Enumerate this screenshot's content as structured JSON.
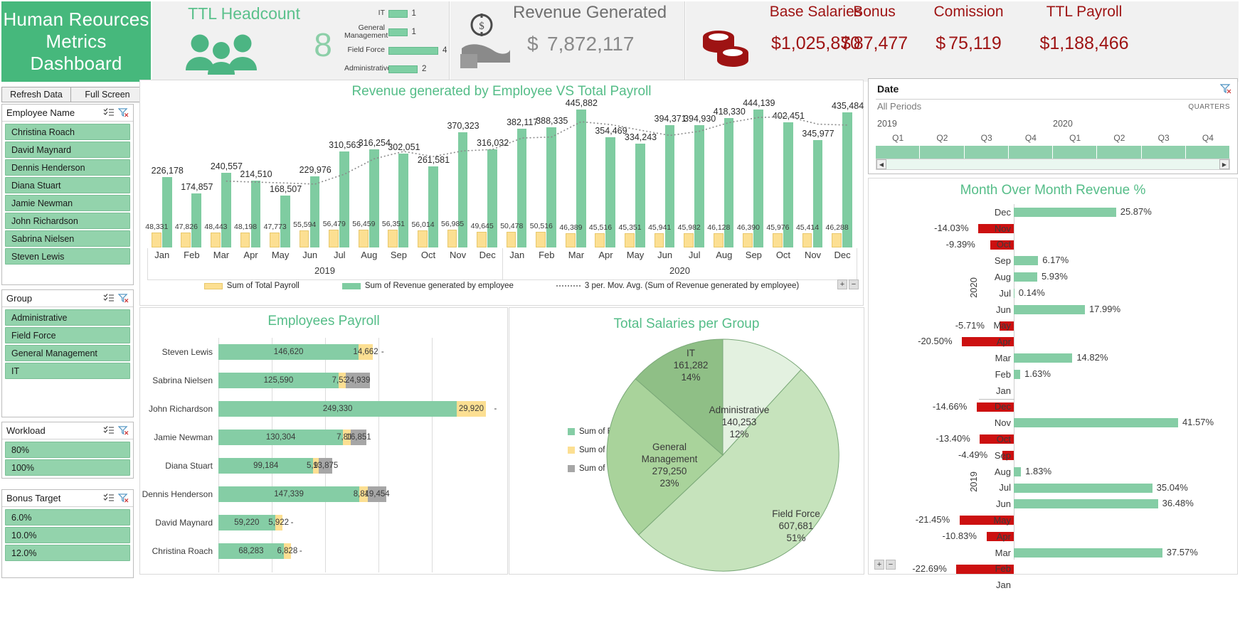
{
  "header": {
    "title": "Human Reources Metrics Dashboard",
    "headcount": {
      "label": "TTL Headcount",
      "total": "8",
      "groups": [
        {
          "label": "IT",
          "value": "1",
          "count": 1
        },
        {
          "label": "General Management",
          "value": "1",
          "count": 1
        },
        {
          "label": "Field Force",
          "value": "4",
          "count": 4
        },
        {
          "label": "Administrative",
          "value": "2",
          "count": 2
        }
      ]
    },
    "revenue": {
      "label": "Revenue Generated",
      "currency": "$",
      "value": "7,872,117",
      "icon": "money-hand-icon"
    },
    "payroll": {
      "icon": "coins-icon",
      "items": [
        {
          "label": "Base Salaries",
          "currency": "",
          "amount": "$1,025,870"
        },
        {
          "label": "Bonus",
          "currency": "$",
          "amount": "87,477"
        },
        {
          "label": "Comission",
          "currency": "$",
          "amount": "75,119"
        },
        {
          "label": "TTL Payroll",
          "currency": "",
          "amount": "$1,188,466"
        }
      ]
    }
  },
  "toolbar": {
    "refresh_label": "Refresh Data",
    "fullscreen_label": "Full Screen"
  },
  "slicers": [
    {
      "title": "Employee Name",
      "items": [
        "Christina Roach",
        "David Maynard",
        "Dennis Henderson",
        "Diana Stuart",
        "Jamie Newman",
        "John Richardson",
        "Sabrina Nielsen",
        "Steven Lewis"
      ]
    },
    {
      "title": "Group",
      "items": [
        "Administrative",
        "Field Force",
        "General Management",
        "IT"
      ]
    },
    {
      "title": "Workload",
      "items": [
        "80%",
        "100%"
      ]
    },
    {
      "title": "Bonus Target",
      "items": [
        "6.0%",
        "10.0%",
        "12.0%"
      ]
    }
  ],
  "timeline": {
    "title": "Date",
    "period": "All Periods",
    "granularity": "QUARTERS",
    "years": [
      "2019",
      "2020"
    ],
    "quarters": [
      "Q1",
      "Q2",
      "Q3",
      "Q4",
      "Q1",
      "Q2",
      "Q3",
      "Q4"
    ]
  },
  "chart_data": [
    {
      "id": "revenue_vs_payroll",
      "type": "bar",
      "title": "Revenue generated by Employee VS Total Payroll",
      "xlabel": "",
      "ylabel": "",
      "grid": false,
      "legend_position": "bottom",
      "group_labels": [
        "2019",
        "2020"
      ],
      "categories": [
        "Jan",
        "Feb",
        "Mar",
        "Apr",
        "May",
        "Jun",
        "Jul",
        "Aug",
        "Sep",
        "Oct",
        "Nov",
        "Dec",
        "Jan",
        "Feb",
        "Mar",
        "Apr",
        "May",
        "Jun",
        "Jul",
        "Aug",
        "Sep",
        "Oct",
        "Nov",
        "Dec"
      ],
      "series": [
        {
          "name": "Sum of Total Payroll",
          "color": "#fcdf92",
          "values": [
            48331,
            47826,
            48443,
            48198,
            47773,
            55594,
            56479,
            56459,
            56351,
            56014,
            56985,
            49645,
            50478,
            50516,
            46389,
            45516,
            45351,
            45941,
            45982,
            46128,
            46390,
            45976,
            45414,
            46288
          ],
          "labels": [
            "48,331",
            "47,826",
            "48,443",
            "48,198",
            "47,773",
            "55,594",
            "56,479",
            "56,459",
            "56,351",
            "56,014",
            "56,985",
            "49,645",
            "50,478",
            "50,516",
            "46,389",
            "45,516",
            "45,351",
            "45,941",
            "45,982",
            "46,128",
            "46,390",
            "45,976",
            "45,414",
            "46,288"
          ]
        },
        {
          "name": "Sum of Revenue generated by employee",
          "color": "#7fcca1",
          "values": [
            226178,
            174857,
            240557,
            214510,
            168507,
            229976,
            310563,
            316254,
            302051,
            261581,
            370323,
            316032,
            382117,
            388335,
            445882,
            354469,
            334243,
            394371,
            394930,
            418330,
            444139,
            402451,
            345977,
            435484
          ],
          "labels": [
            "226,178",
            "174,857",
            "240,557",
            "214,510",
            "168,507",
            "229,976",
            "310,563",
            "316,254",
            "302,051",
            "261,581",
            "370,323",
            "316,032",
            "382,117",
            "388,335",
            "445,882",
            "354,469",
            "334,243",
            "394,371",
            "394,930",
            "418,330",
            "444,139",
            "402,451",
            "345,977",
            "435,484"
          ]
        },
        {
          "name": "3 per. Mov. Avg. (Sum of Revenue generated by employee)",
          "color": "#8a8a8a",
          "type": "line",
          "style": "dotted",
          "values": [
            null,
            null,
            213864,
            210641,
            207858,
            204331,
            236349,
            285598,
            309623,
            293295,
            311318,
            315979,
            352812,
            356161,
            405445,
            396229,
            378198,
            361028,
            374515,
            402544,
            419133,
            421640,
            397522,
            394637
          ]
        }
      ]
    },
    {
      "id": "employees_payroll",
      "type": "bar",
      "orientation": "horizontal",
      "stacked": true,
      "title": "Employees Payroll",
      "categories": [
        "Steven Lewis",
        "Sabrina Nielsen",
        "John Richardson",
        "Jamie Newman",
        "Diana Stuart",
        "Dennis Henderson",
        "David Maynard",
        "Christina Roach"
      ],
      "series": [
        {
          "name": "Sum of Base salary",
          "color": "#85cda5",
          "values": [
            146620,
            125590,
            249330,
            130304,
            99184,
            147339,
            59220,
            68283
          ],
          "labels": [
            "146,620",
            "125,590",
            "249,330",
            "130,304",
            "99,184",
            "147,339",
            "59,220",
            "68,283"
          ]
        },
        {
          "name": "Sum of Bonus accrual",
          "color": "#fcdf92",
          "values": [
            14662,
            7535,
            29920,
            7818,
            5951,
            8840,
            5922,
            6828
          ],
          "labels": [
            "14,662",
            "7,535",
            "29,920",
            "7,818",
            "5,951",
            "8,840",
            "5,922",
            "6,828"
          ]
        },
        {
          "name": "Sum of Comission",
          "color": "#a6a6a6",
          "values": [
            0,
            24939,
            0,
            16851,
            13875,
            19454,
            0,
            0
          ],
          "labels": [
            "-",
            "24,939",
            "-",
            "16,851",
            "13,875",
            "19,454",
            "-",
            "-"
          ]
        }
      ]
    },
    {
      "id": "total_salaries_per_group",
      "type": "pie",
      "title": "Total Salaries per Group",
      "legend_position": "left",
      "legend_entries": [
        "Sum of Base salary",
        "Sum of Bonus accrual",
        "Sum of Comission"
      ],
      "categories": [
        "Administrative",
        "Field Force",
        "General Management",
        "IT"
      ],
      "values": [
        140253,
        607681,
        279250,
        161282
      ],
      "percents": [
        "12%",
        "51%",
        "23%",
        "14%"
      ],
      "labels": [
        "140,253",
        "607,681",
        "279,250",
        "161,282"
      ],
      "colors": [
        "#e3f1e0",
        "#c6e3bc",
        "#a9d39b",
        "#8fbf86"
      ]
    },
    {
      "id": "month_over_month_revenue",
      "type": "bar",
      "orientation": "horizontal",
      "title": "Month Over Month Revenue %",
      "group_labels": [
        "2020",
        "2019"
      ],
      "positive_color": "#85cda5",
      "negative_color": "#cc1010",
      "rows": [
        {
          "year": "2020",
          "month": "Dec",
          "value": 25.87,
          "label": "25.87%"
        },
        {
          "year": "2020",
          "month": "Nov",
          "value": -14.03,
          "label": "-14.03%"
        },
        {
          "year": "2020",
          "month": "Oct",
          "value": -9.39,
          "label": "-9.39%"
        },
        {
          "year": "2020",
          "month": "Sep",
          "value": 6.17,
          "label": "6.17%"
        },
        {
          "year": "2020",
          "month": "Aug",
          "value": 5.93,
          "label": "5.93%"
        },
        {
          "year": "2020",
          "month": "Jul",
          "value": 0.14,
          "label": "0.14%"
        },
        {
          "year": "2020",
          "month": "Jun",
          "value": 17.99,
          "label": "17.99%"
        },
        {
          "year": "2020",
          "month": "May",
          "value": -5.71,
          "label": "-5.71%"
        },
        {
          "year": "2020",
          "month": "Apr",
          "value": -20.5,
          "label": "-20.50%"
        },
        {
          "year": "2020",
          "month": "Mar",
          "value": 14.82,
          "label": "14.82%"
        },
        {
          "year": "2020",
          "month": "Feb",
          "value": 1.63,
          "label": "1.63%"
        },
        {
          "year": "2020",
          "month": "Jan",
          "value": 0,
          "label": ""
        },
        {
          "year": "2019",
          "month": "Dec",
          "value": -14.66,
          "label": "-14.66%"
        },
        {
          "year": "2019",
          "month": "Nov",
          "value": 41.57,
          "label": "41.57%"
        },
        {
          "year": "2019",
          "month": "Oct",
          "value": -13.4,
          "label": "-13.40%"
        },
        {
          "year": "2019",
          "month": "Sep",
          "value": -4.49,
          "label": "-4.49%"
        },
        {
          "year": "2019",
          "month": "Aug",
          "value": 1.83,
          "label": "1.83%"
        },
        {
          "year": "2019",
          "month": "Jul",
          "value": 35.04,
          "label": "35.04%"
        },
        {
          "year": "2019",
          "month": "Jun",
          "value": 36.48,
          "label": "36.48%"
        },
        {
          "year": "2019",
          "month": "May",
          "value": -21.45,
          "label": "-21.45%"
        },
        {
          "year": "2019",
          "month": "Apr",
          "value": -10.83,
          "label": "-10.83%"
        },
        {
          "year": "2019",
          "month": "Mar",
          "value": 37.57,
          "label": "37.57%"
        },
        {
          "year": "2019",
          "month": "Feb",
          "value": -22.69,
          "label": "-22.69%"
        },
        {
          "year": "2019",
          "month": "Jan",
          "value": 0,
          "label": ""
        }
      ]
    }
  ],
  "controls": {
    "plus": "+",
    "minus": "−",
    "left_arrow": "◀",
    "right_arrow": "▶"
  }
}
